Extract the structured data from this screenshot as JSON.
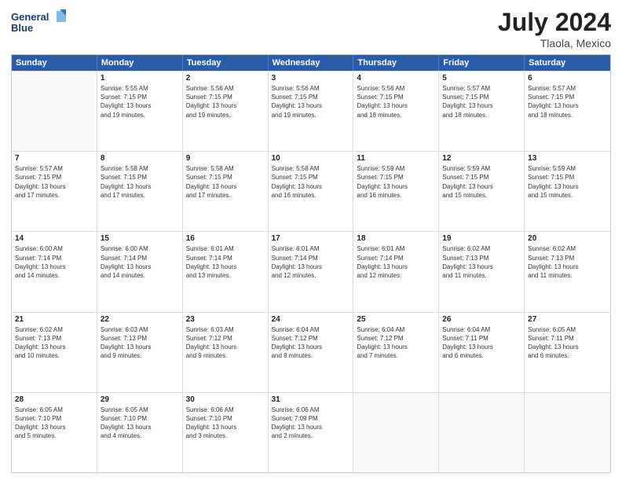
{
  "header": {
    "logo_line1": "General",
    "logo_line2": "Blue",
    "main_title": "July 2024",
    "subtitle": "Tlaola, Mexico"
  },
  "calendar": {
    "days_of_week": [
      "Sunday",
      "Monday",
      "Tuesday",
      "Wednesday",
      "Thursday",
      "Friday",
      "Saturday"
    ],
    "weeks": [
      [
        {
          "day": "",
          "info": ""
        },
        {
          "day": "1",
          "info": "Sunrise: 5:55 AM\nSunset: 7:15 PM\nDaylight: 13 hours\nand 19 minutes."
        },
        {
          "day": "2",
          "info": "Sunrise: 5:56 AM\nSunset: 7:15 PM\nDaylight: 13 hours\nand 19 minutes."
        },
        {
          "day": "3",
          "info": "Sunrise: 5:56 AM\nSunset: 7:15 PM\nDaylight: 13 hours\nand 19 minutes."
        },
        {
          "day": "4",
          "info": "Sunrise: 5:56 AM\nSunset: 7:15 PM\nDaylight: 13 hours\nand 18 minutes."
        },
        {
          "day": "5",
          "info": "Sunrise: 5:57 AM\nSunset: 7:15 PM\nDaylight: 13 hours\nand 18 minutes."
        },
        {
          "day": "6",
          "info": "Sunrise: 5:57 AM\nSunset: 7:15 PM\nDaylight: 13 hours\nand 18 minutes."
        }
      ],
      [
        {
          "day": "7",
          "info": "Sunrise: 5:57 AM\nSunset: 7:15 PM\nDaylight: 13 hours\nand 17 minutes."
        },
        {
          "day": "8",
          "info": "Sunrise: 5:58 AM\nSunset: 7:15 PM\nDaylight: 13 hours\nand 17 minutes."
        },
        {
          "day": "9",
          "info": "Sunrise: 5:58 AM\nSunset: 7:15 PM\nDaylight: 13 hours\nand 17 minutes."
        },
        {
          "day": "10",
          "info": "Sunrise: 5:58 AM\nSunset: 7:15 PM\nDaylight: 13 hours\nand 16 minutes."
        },
        {
          "day": "11",
          "info": "Sunrise: 5:59 AM\nSunset: 7:15 PM\nDaylight: 13 hours\nand 16 minutes."
        },
        {
          "day": "12",
          "info": "Sunrise: 5:59 AM\nSunset: 7:15 PM\nDaylight: 13 hours\nand 15 minutes."
        },
        {
          "day": "13",
          "info": "Sunrise: 5:59 AM\nSunset: 7:15 PM\nDaylight: 13 hours\nand 15 minutes."
        }
      ],
      [
        {
          "day": "14",
          "info": "Sunrise: 6:00 AM\nSunset: 7:14 PM\nDaylight: 13 hours\nand 14 minutes."
        },
        {
          "day": "15",
          "info": "Sunrise: 6:00 AM\nSunset: 7:14 PM\nDaylight: 13 hours\nand 14 minutes."
        },
        {
          "day": "16",
          "info": "Sunrise: 6:01 AM\nSunset: 7:14 PM\nDaylight: 13 hours\nand 13 minutes."
        },
        {
          "day": "17",
          "info": "Sunrise: 6:01 AM\nSunset: 7:14 PM\nDaylight: 13 hours\nand 12 minutes."
        },
        {
          "day": "18",
          "info": "Sunrise: 6:01 AM\nSunset: 7:14 PM\nDaylight: 13 hours\nand 12 minutes."
        },
        {
          "day": "19",
          "info": "Sunrise: 6:02 AM\nSunset: 7:13 PM\nDaylight: 13 hours\nand 11 minutes."
        },
        {
          "day": "20",
          "info": "Sunrise: 6:02 AM\nSunset: 7:13 PM\nDaylight: 13 hours\nand 11 minutes."
        }
      ],
      [
        {
          "day": "21",
          "info": "Sunrise: 6:02 AM\nSunset: 7:13 PM\nDaylight: 13 hours\nand 10 minutes."
        },
        {
          "day": "22",
          "info": "Sunrise: 6:03 AM\nSunset: 7:13 PM\nDaylight: 13 hours\nand 9 minutes."
        },
        {
          "day": "23",
          "info": "Sunrise: 6:03 AM\nSunset: 7:12 PM\nDaylight: 13 hours\nand 9 minutes."
        },
        {
          "day": "24",
          "info": "Sunrise: 6:04 AM\nSunset: 7:12 PM\nDaylight: 13 hours\nand 8 minutes."
        },
        {
          "day": "25",
          "info": "Sunrise: 6:04 AM\nSunset: 7:12 PM\nDaylight: 13 hours\nand 7 minutes."
        },
        {
          "day": "26",
          "info": "Sunrise: 6:04 AM\nSunset: 7:11 PM\nDaylight: 13 hours\nand 6 minutes."
        },
        {
          "day": "27",
          "info": "Sunrise: 6:05 AM\nSunset: 7:11 PM\nDaylight: 13 hours\nand 6 minutes."
        }
      ],
      [
        {
          "day": "28",
          "info": "Sunrise: 6:05 AM\nSunset: 7:10 PM\nDaylight: 13 hours\nand 5 minutes."
        },
        {
          "day": "29",
          "info": "Sunrise: 6:05 AM\nSunset: 7:10 PM\nDaylight: 13 hours\nand 4 minutes."
        },
        {
          "day": "30",
          "info": "Sunrise: 6:06 AM\nSunset: 7:10 PM\nDaylight: 13 hours\nand 3 minutes."
        },
        {
          "day": "31",
          "info": "Sunrise: 6:06 AM\nSunset: 7:09 PM\nDaylight: 13 hours\nand 2 minutes."
        },
        {
          "day": "",
          "info": ""
        },
        {
          "day": "",
          "info": ""
        },
        {
          "day": "",
          "info": ""
        }
      ]
    ]
  }
}
